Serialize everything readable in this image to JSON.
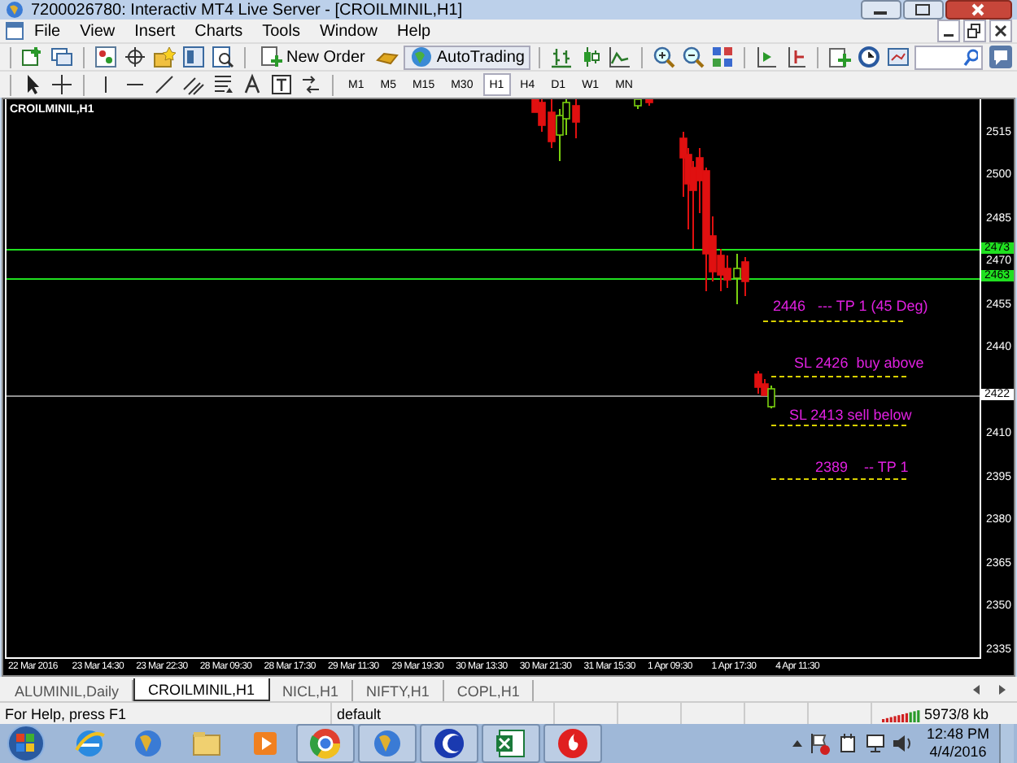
{
  "window": {
    "title": "7200026780: Interactiv MT4 Live Server - [CROILMINIL,H1]"
  },
  "menu": [
    "File",
    "View",
    "Insert",
    "Charts",
    "Tools",
    "Window",
    "Help"
  ],
  "toolbar": {
    "new_order": "New Order",
    "auto_trading": "AutoTrading"
  },
  "timeframes": [
    {
      "label": "M1",
      "selected": false
    },
    {
      "label": "M5",
      "selected": false
    },
    {
      "label": "M15",
      "selected": false
    },
    {
      "label": "M30",
      "selected": false
    },
    {
      "label": "H1",
      "selected": true
    },
    {
      "label": "H4",
      "selected": false
    },
    {
      "label": "D1",
      "selected": false
    },
    {
      "label": "W1",
      "selected": false
    },
    {
      "label": "MN",
      "selected": false
    }
  ],
  "chart": {
    "symbol": "CROILMINIL,H1",
    "price_axis": [
      "2515",
      "2500",
      "2485",
      "2470",
      "2455",
      "2440",
      "2410",
      "2395",
      "2380",
      "2365",
      "2350",
      "2335"
    ],
    "levels": [
      {
        "price": "2473",
        "kind": "green"
      },
      {
        "price": "2463",
        "kind": "green"
      },
      {
        "price": "2422",
        "kind": "grey"
      }
    ],
    "annotations": [
      "2446   --- TP 1 (45 Deg)",
      "SL 2426  buy above",
      "SL 2413 sell below",
      "2389    -- TP 1"
    ],
    "time_axis": [
      "22 Mar 2016",
      "23 Mar 14:30",
      "23 Mar 22:30",
      "28 Mar 09:30",
      "28 Mar 17:30",
      "29 Mar 11:30",
      "29 Mar 19:30",
      "30 Mar 13:30",
      "30 Mar 21:30",
      "31 Mar 15:30",
      "1 Apr 09:30",
      "1 Apr 17:30",
      "4 Apr 11:30"
    ]
  },
  "tabs": [
    {
      "label": "ALUMINIL,Daily",
      "selected": false
    },
    {
      "label": "CROILMINIL,H1",
      "selected": true
    },
    {
      "label": "NICL,H1",
      "selected": false
    },
    {
      "label": "NIFTY,H1",
      "selected": false
    },
    {
      "label": "COPL,H1",
      "selected": false
    }
  ],
  "status_bar": {
    "help": "For Help, press F1",
    "profile": "default",
    "traffic": "5973/8 kb"
  },
  "taskbar": {
    "time": "12:48 PM",
    "date": "4/4/2016"
  }
}
